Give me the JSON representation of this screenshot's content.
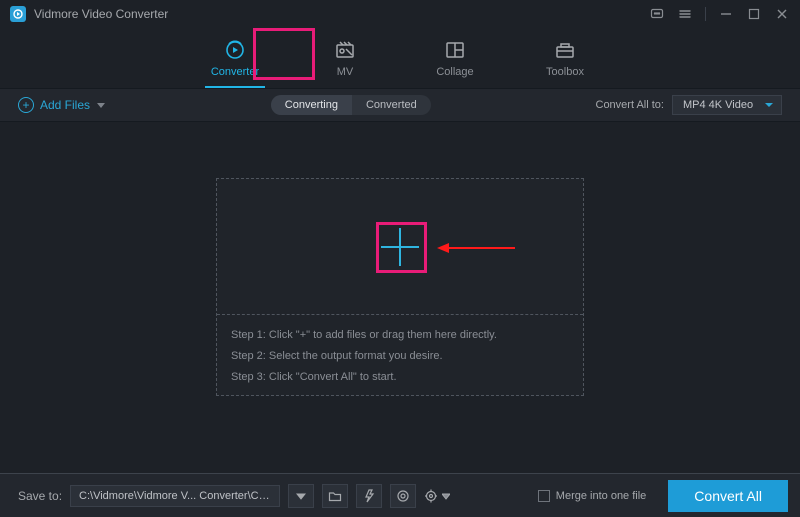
{
  "titlebar": {
    "app_name": "Vidmore Video Converter"
  },
  "tabs": {
    "converter": "Converter",
    "mv": "MV",
    "collage": "Collage",
    "toolbox": "Toolbox"
  },
  "subbar": {
    "add_files": "Add Files",
    "converting": "Converting",
    "converted": "Converted",
    "convert_all_to": "Convert All to:",
    "format_selected": "MP4 4K Video"
  },
  "stage": {
    "step1": "Step 1: Click \"+\" to add files or drag them here directly.",
    "step2": "Step 2: Select the output format you desire.",
    "step3": "Step 3: Click \"Convert All\" to start."
  },
  "bottombar": {
    "save_to_label": "Save to:",
    "save_to_path": "C:\\Vidmore\\Vidmore V... Converter\\Converted",
    "merge_label": "Merge into one file",
    "convert_all_btn": "Convert All"
  }
}
